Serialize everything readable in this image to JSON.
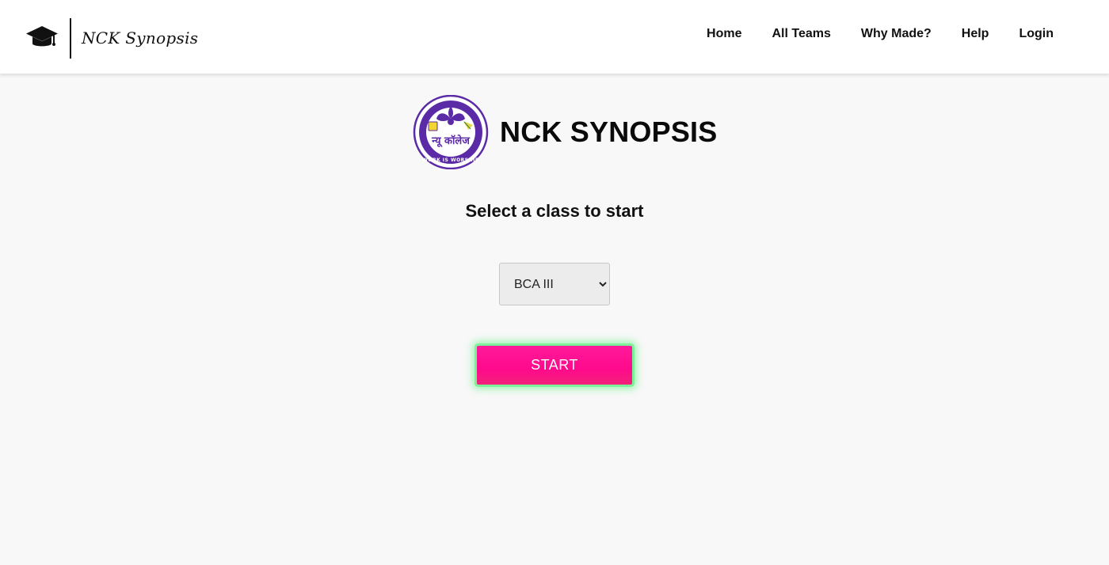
{
  "header": {
    "brand_name": "NCK Synopsis",
    "brand_icon": "graduation-cap-icon",
    "nav": [
      {
        "label": "Home"
      },
      {
        "label": "All Teams"
      },
      {
        "label": "Why Made?"
      },
      {
        "label": "Help"
      },
      {
        "label": "Login"
      }
    ]
  },
  "main": {
    "logo": {
      "name": "new-college-kolhapur-logo",
      "script_text": "न्यू कॉलेज",
      "motto": "WORK IS WORSHIP",
      "color": "#5b2aa6"
    },
    "title": "NCK SYNOPSIS",
    "subtitle": "Select a class to start",
    "class_select": {
      "selected": "BCA III",
      "options": [
        "BCA III"
      ]
    },
    "start_button": {
      "label": "START",
      "color": "#ff0a8c",
      "glow_color": "#6ef08c"
    }
  }
}
